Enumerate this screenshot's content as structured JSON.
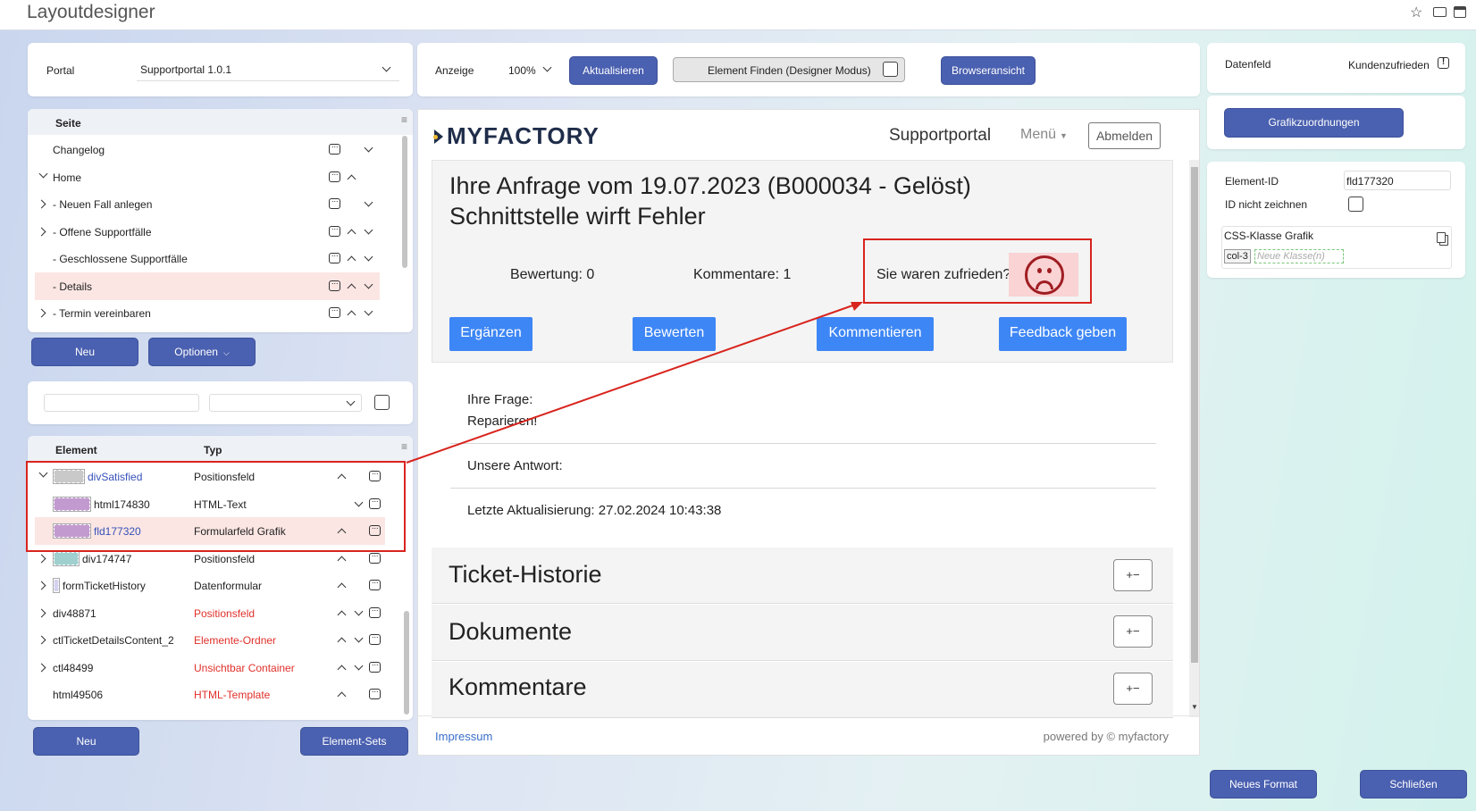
{
  "app_title": "Layoutdesigner",
  "titlebar_icons": [
    "star-icon",
    "mail-icon",
    "window-icon"
  ],
  "portal": {
    "label": "Portal",
    "value": "Supportportal 1.0.1"
  },
  "toolbar": {
    "anzeige_label": "Anzeige",
    "zoom": "100%",
    "refresh": "Aktualisieren",
    "find": "Element Finden (Designer Modus)",
    "browser": "Browseransicht"
  },
  "pages": {
    "header": "Seite",
    "items": [
      {
        "label": "Changelog",
        "expand": "",
        "arrows": "down"
      },
      {
        "label": "Home",
        "expand": "down",
        "arrows": "up"
      },
      {
        "label": "- Neuen Fall anlegen",
        "expand": "right",
        "arrows": "down"
      },
      {
        "label": "- Offene Supportfälle",
        "expand": "right",
        "arrows": "updown"
      },
      {
        "label": "- Geschlossene Supportfälle",
        "expand": "",
        "arrows": "updown"
      },
      {
        "label": "- Details",
        "expand": "",
        "arrows": "updown",
        "selected": true
      },
      {
        "label": "- Termin vereinbaren",
        "expand": "right",
        "arrows": "updown"
      }
    ]
  },
  "page_buttons": {
    "new": "Neu",
    "options": "Optionen"
  },
  "elements": {
    "col_element": "Element",
    "col_type": "Typ",
    "rows": [
      {
        "name": "divSatisfied",
        "type": "Positionsfeld",
        "swatch": "#c9c9c9",
        "link": true,
        "red": false,
        "expand": "down",
        "arrows": "up"
      },
      {
        "name": "html174830",
        "type": "HTML-Text",
        "swatch": "#c39ad0",
        "link": false,
        "red": false,
        "expand": "",
        "arrows": "down"
      },
      {
        "name": "fld177320",
        "type": "Formularfeld Grafik",
        "swatch": "#c39ad0",
        "link": true,
        "red": false,
        "expand": "",
        "arrows": "up",
        "selected": true
      },
      {
        "name": "div174747",
        "type": "Positionsfeld",
        "swatch": "#9fd0cf",
        "link": false,
        "red": false,
        "expand": "right",
        "arrows": "up"
      },
      {
        "name": "formTicketHistory",
        "type": "Datenformular",
        "swatch": "#d4d2f0",
        "link": false,
        "red": false,
        "expand": "right",
        "arrows": "up"
      },
      {
        "name": "div48871",
        "type": "Positionsfeld",
        "swatch": "",
        "link": false,
        "red": true,
        "expand": "right",
        "arrows": "updown"
      },
      {
        "name": "ctlTicketDetailsContent_2",
        "type": "Elemente-Ordner",
        "swatch": "",
        "link": false,
        "red": true,
        "expand": "right",
        "arrows": "updown"
      },
      {
        "name": "ctl48499",
        "type": "Unsichtbar Container",
        "swatch": "",
        "link": false,
        "red": true,
        "expand": "right",
        "arrows": "updown"
      },
      {
        "name": "html49506",
        "type": "HTML-Template",
        "swatch": "",
        "link": false,
        "red": true,
        "expand": "",
        "arrows": "up"
      }
    ]
  },
  "element_buttons": {
    "new": "Neu",
    "sets": "Element-Sets"
  },
  "preview": {
    "logo": "MYFACTORY",
    "nav_title": "Supportportal",
    "menu": "Menü",
    "logout": "Abmelden",
    "heading1": "Ihre Anfrage vom 19.07.2023 (B000034 - Gelöst)",
    "heading2": "Schnittstelle wirft Fehler",
    "rating": "Bewertung: 0",
    "comments": "Kommentare: 1",
    "satisfied": "Sie waren zufrieden?",
    "buttons": [
      "Ergänzen",
      "Bewerten",
      "Kommentieren",
      "Feedback geben"
    ],
    "question_label": "Ihre Frage:",
    "question": "Reparieren!",
    "answer_label": "Unsere Antwort:",
    "updated": "Letzte Aktualisierung: 27.02.2024 10:43:38",
    "sections": [
      "Ticket-Historie",
      "Dokumente",
      "Kommentare"
    ],
    "toggle": "+−",
    "footer_link": "Impressum",
    "footer_right": "powered by © myfactory"
  },
  "right": {
    "datenfeld_label": "Datenfeld",
    "datenfeld_value": "Kundenzufrieden",
    "grafik_button": "Grafikzuordnungen",
    "id_label": "Element-ID",
    "id_value": "fld177320",
    "no_id_label": "ID nicht zeichnen",
    "css_label": "CSS-Klasse Grafik",
    "css_tag": "col-3",
    "css_placeholder": "Neue Klasse(n)",
    "new_format": "Neues Format",
    "close": "Schließen"
  },
  "colors": {
    "accent": "#4a60b0",
    "preview_button": "#3d86f5",
    "highlight": "#d8241e",
    "selected_row": "#fbe6e3"
  }
}
